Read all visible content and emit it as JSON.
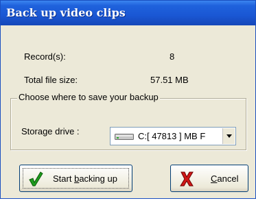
{
  "window": {
    "title": "Back up video clips"
  },
  "info": {
    "records_label": "Record(s):",
    "records_value": "8",
    "size_label": "Total file size:",
    "size_value": "57.51 MB"
  },
  "save_group": {
    "legend": "Choose where to save your backup",
    "storage_label": "Storage drive :",
    "selected_drive": "C:[ 47813 ] MB F"
  },
  "buttons": {
    "start_pre": "Start ",
    "start_accel": "b",
    "start_post": "acking up",
    "cancel_accel": "C",
    "cancel_post": "ancel"
  },
  "icons": {
    "start": "green-checkmark-icon",
    "cancel": "red-x-icon",
    "drive": "hard-drive-icon"
  }
}
